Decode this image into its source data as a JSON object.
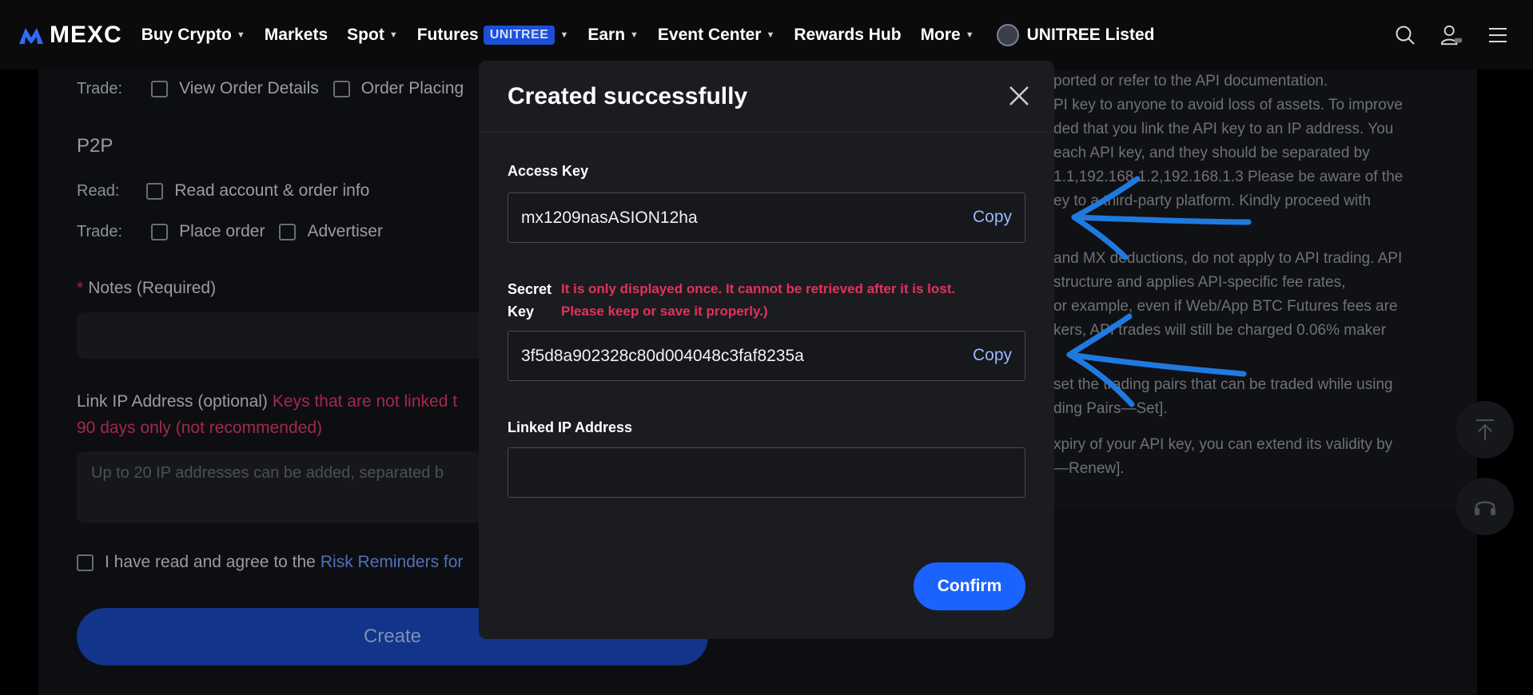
{
  "nav": {
    "logo": "MEXC",
    "items": [
      "Buy Crypto",
      "Markets",
      "Spot",
      "Futures",
      "Earn",
      "Event Center",
      "Rewards Hub",
      "More"
    ],
    "futures_badge": "UNITREE",
    "listed": "UNITREE Listed"
  },
  "background": {
    "trade_label": "Trade:",
    "trade_opts": [
      "View Order Details",
      "Order Placing"
    ],
    "p2p_title": "P2P",
    "read_label": "Read:",
    "read_opt": "Read account & order info",
    "trade2_label": "Trade:",
    "trade2_opts": [
      "Place order",
      "Advertiser"
    ],
    "notes_star": "*",
    "notes_label": "Notes (Required)",
    "link_ip_label": "Link IP Address (optional)",
    "link_ip_warning_1": "Keys that are not linked t",
    "link_ip_warning_2": "90 days only (not recommended)",
    "ip_placeholder": "Up to 20 IP addresses can be added, separated b",
    "agree_text": "I have read and agree to the",
    "agree_link": "Risk Reminders for",
    "create_button": "Create",
    "right_lines": [
      "ported or refer to the API documentation.",
      "PI key to anyone to avoid loss of assets. To improve",
      "ded that you link the API key to an IP address. You",
      "each API key, and they should be separated by",
      "1.1,192.168.1.2,192.168.1.3 Please be aware of the",
      "ey to a third-party platform. Kindly proceed with",
      "and MX deductions, do not apply to API trading. API",
      "structure and applies API-specific fee rates,",
      "or example, even if Web/App BTC Futures fees are",
      "kers, API trades will still be charged 0.06% maker",
      "set the trading pairs that can be traded while using",
      "ding Pairs—Set].",
      "xpiry of your API key, you can extend its validity by",
      "—Renew]."
    ]
  },
  "modal": {
    "title": "Created successfully",
    "access_key_label": "Access Key",
    "access_key_value": "mx1209nasASION12ha",
    "copy_label": "Copy",
    "secret_key_label_1": "Secret",
    "secret_key_label_2": "Key",
    "secret_warning_1": "It is only displayed once. It cannot be retrieved after it is lost.",
    "secret_warning_2": "Please keep or save it properly.)",
    "secret_key_value": "3f5d8a902328c80d004048c3faf8235a",
    "linked_ip_label": "Linked IP Address",
    "linked_ip_value": "",
    "confirm_button": "Confirm"
  },
  "colors": {
    "accent": "#1a63ff",
    "warning": "#e0335d",
    "annotation_arrow": "#1f7ae0"
  }
}
